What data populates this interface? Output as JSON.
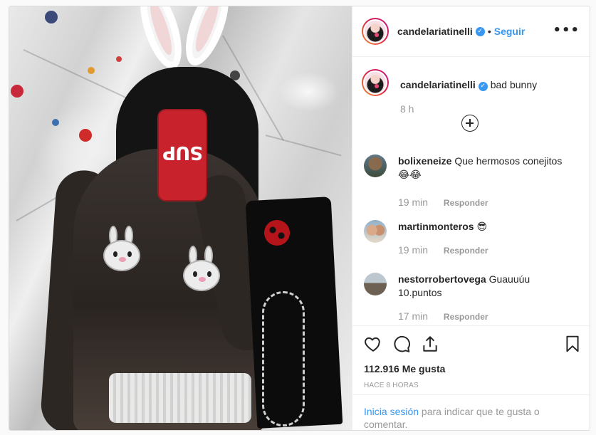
{
  "post": {
    "author": "candelariatinelli",
    "follow_label": "Seguir",
    "more_label": "•••",
    "verified_mark": "✓",
    "separator": "•"
  },
  "caption": {
    "username": "candelariatinelli",
    "text": "bad bunny",
    "time": "8 h"
  },
  "comments": [
    {
      "username": "bolixeneize",
      "text": "Que hermosos conejitos 😂😂",
      "time": "19 min",
      "reply": "Responder"
    },
    {
      "username": "martinmonteros",
      "text": "😎",
      "time": "19 min",
      "reply": "Responder"
    },
    {
      "username": "nestorrobertovega",
      "text": "Guauuúu 10.puntos",
      "time": "17 min",
      "reply": "Responder"
    }
  ],
  "photo": {
    "phone_text": "SUP"
  },
  "footer": {
    "likes": "112.916 Me gusta",
    "timestamp": "HACE 8 HORAS",
    "login_link": "Inicia sesión",
    "login_rest": " para indicar que te gusta o comentar."
  },
  "icons": {
    "like": "heart-icon",
    "comment": "comment-icon",
    "share": "share-icon",
    "save": "bookmark-icon",
    "add": "plus-circle-icon",
    "more": "more-options-icon"
  },
  "colors": {
    "link": "#3897f0",
    "muted": "#999999",
    "text": "#262626",
    "phone": "#c8232c"
  }
}
